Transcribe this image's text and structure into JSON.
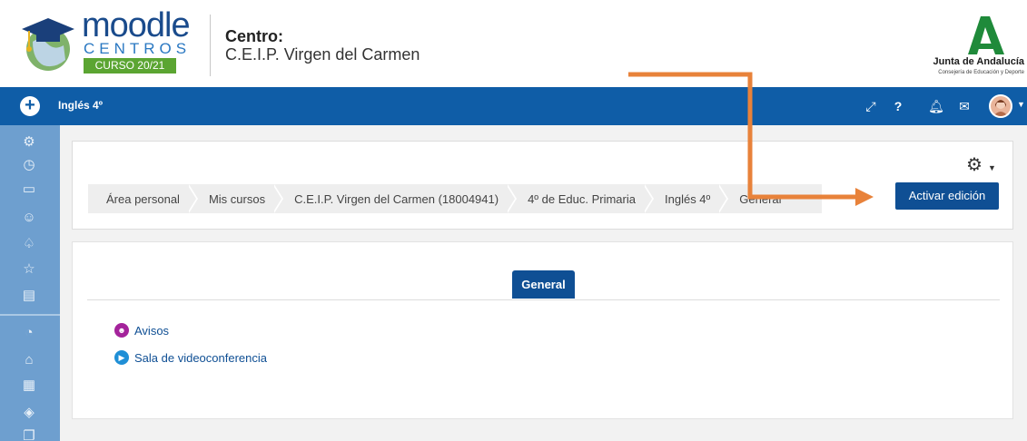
{
  "banner": {
    "moodle_word": "moodle",
    "centros_word": "CENTROS",
    "curso_badge": "CURSO 20/21",
    "centro_label": "Centro:",
    "centro_name": "C.E.I.P. Virgen del Carmen",
    "junta_name": "Junta de Andalucía",
    "junta_sub": "Consejería de Educación y Deporte"
  },
  "navbar": {
    "course_title": "Inglés 4º",
    "icons": [
      "expand-icon",
      "help-icon",
      "bell-icon",
      "envelope-icon",
      "avatar",
      "caret-down-icon"
    ]
  },
  "sidebar": {
    "icons": [
      "gears-icon",
      "clock-icon",
      "folder-icon",
      "users-icon",
      "award-icon",
      "star-icon",
      "book-icon",
      "dashboard-icon",
      "home-icon",
      "calendar-icon",
      "graduation-cap-icon",
      "files-icon"
    ]
  },
  "header": {
    "breadcrumb": [
      "Área personal",
      "Mis cursos",
      "C.E.I.P. Virgen del Carmen (18004941)",
      "4º de Educ. Primaria",
      "Inglés 4º",
      "General"
    ],
    "edit_button": "Activar edición"
  },
  "content": {
    "tab_label": "General",
    "activities": [
      {
        "label": "Avisos",
        "icon": "forum-icon",
        "color": "#a4239b"
      },
      {
        "label": "Sala de videoconferencia",
        "icon": "videoconference-icon",
        "color": "#1f8fd6"
      }
    ]
  },
  "colors": {
    "navbar": "#0f5da7",
    "sidebar": "#6e9fcf",
    "primary_button": "#0f4f94",
    "arrow": "#e8823a",
    "curso_badge": "#5ba532"
  }
}
